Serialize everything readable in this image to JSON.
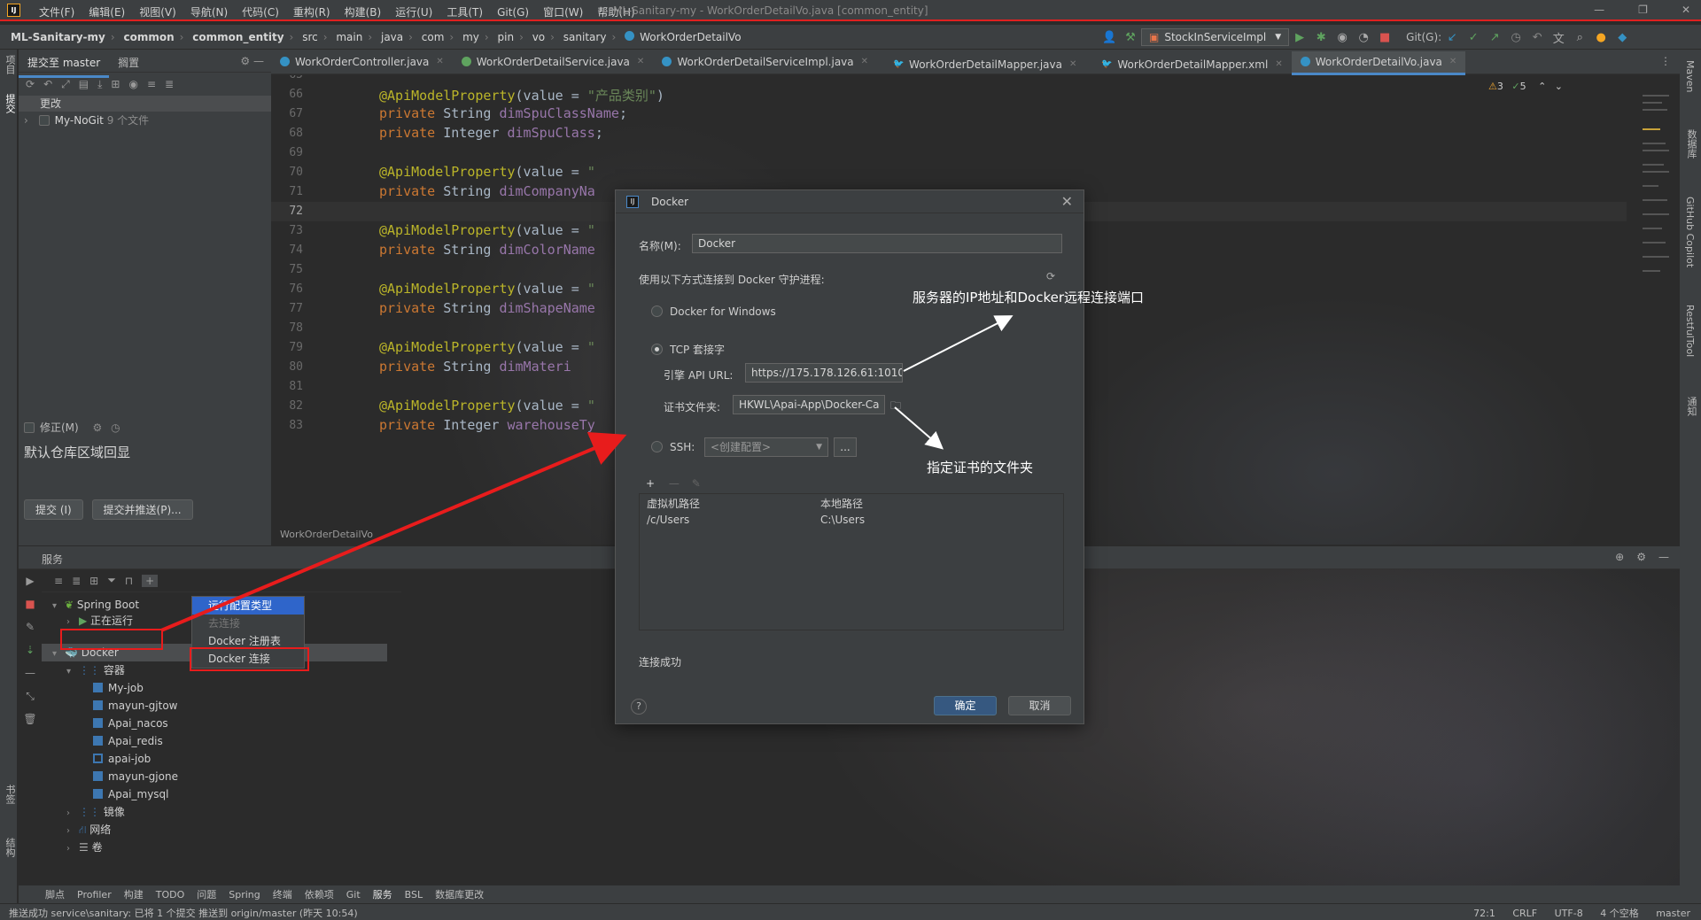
{
  "app": {
    "title": "ML-Sanitary-my - WorkOrderDetailVo.java [common_entity]",
    "menu": [
      "文件(F)",
      "编辑(E)",
      "视图(V)",
      "导航(N)",
      "代码(C)",
      "重构(R)",
      "构建(B)",
      "运行(U)",
      "工具(T)",
      "Git(G)",
      "窗口(W)",
      "帮助(H)"
    ]
  },
  "navbar": {
    "crumbs": [
      "ML-Sanitary-my",
      "common",
      "common_entity",
      "src",
      "main",
      "java",
      "com",
      "my",
      "pin",
      "vo",
      "sanitary",
      "WorkOrderDetailVo"
    ],
    "run_config": "StockInServiceImpl",
    "git_label": "Git(G):"
  },
  "left_strip": {
    "project": "项目",
    "commit": "提交",
    "bookmarks": "书签",
    "structure": "结构"
  },
  "right_strip": {
    "maven": "Maven",
    "database": "数据库",
    "copilot": "GitHub Copilot",
    "restful": "RestfulTool",
    "notifications": "通知"
  },
  "commit_panel": {
    "tab_commit": "提交至 master",
    "tab_shelf": "搁置",
    "changes_group": "更改",
    "repo_name": "My-NoGit",
    "repo_count": "9 个文件",
    "amend_label": "修正(M)",
    "message": "默认仓库区域回显",
    "commit_btn": "提交 (I)",
    "commit_push_btn": "提交并推送(P)..."
  },
  "editor": {
    "tabs": [
      {
        "label": "WorkOrderController.java",
        "icon": "class-icon"
      },
      {
        "label": "WorkOrderDetailService.java",
        "icon": "interface-icon"
      },
      {
        "label": "WorkOrderDetailServiceImpl.java",
        "icon": "class-icon"
      },
      {
        "label": "WorkOrderDetailMapper.java",
        "icon": "mapper-icon"
      },
      {
        "label": "WorkOrderDetailMapper.xml",
        "icon": "xml-icon"
      },
      {
        "label": "WorkOrderDetailVo.java",
        "icon": "class-icon"
      }
    ],
    "inspections": {
      "warnings": "3",
      "ok": "5"
    },
    "line_numbers": [
      "65",
      "66",
      "67",
      "68",
      "69",
      "70",
      "71",
      "72",
      "73",
      "74",
      "75",
      "76",
      "77",
      "78",
      "79",
      "80",
      "81",
      "82",
      "83"
    ],
    "code": {
      "l66_ann": "@ApiModelProperty",
      "l66_str": "\"产品类别\"",
      "l67_name": "dimSpuClassName",
      "l68_name": "dimSpuClass",
      "l71_name": "dimCompanyNa",
      "l74_name": "dimColorName",
      "l77_name": "dimShapeName",
      "l80_name": "dimMateri",
      "l83_name": "warehouseTy",
      "quote": "\"",
      "value_eq": "(value = ",
      "private": "private",
      "string": "String",
      "integer": "Integer"
    },
    "breadcrumb": "WorkOrderDetailVo"
  },
  "services": {
    "title": "服务",
    "tree": {
      "spring_boot": "Spring Boot",
      "running": "正在运行",
      "docker": "Docker",
      "containers": "容器",
      "container_items": [
        "My-job",
        "mayun-gjtow",
        "Apai_nacos",
        "Apai_redis",
        "apai-job",
        "mayun-gjone",
        "Apai_mysql"
      ],
      "images": "镜像",
      "networks": "网络",
      "volumes": "卷"
    },
    "context_menu": [
      "运行配置类型",
      "去连接",
      "Docker 注册表",
      "Docker 连接"
    ]
  },
  "dialog": {
    "title": "Docker",
    "name_label": "名称(M):",
    "name_value": "Docker",
    "connect_label": "使用以下方式连接到 Docker 守护进程:",
    "opt_windows": "Docker for Windows",
    "opt_tcp": "TCP 套接字",
    "api_url_label": "引擎 API URL:",
    "api_url_value": "https://175.178.126.61:1010",
    "cert_label": "证书文件夹:",
    "cert_value": "HKWL\\Apai-App\\Docker-Ca",
    "opt_ssh": "SSH:",
    "ssh_placeholder": "<创建配置>",
    "ssh_more": "...",
    "col_vm_path": "虚拟机路径",
    "col_local_path": "本地路径",
    "row_vm_path": "/c/Users",
    "row_local_path": "C:\\Users",
    "status": "连接成功",
    "ok": "确定",
    "cancel": "取消",
    "help": "?"
  },
  "annotations": {
    "ip_note": "服务器的IP地址和Docker远程连接端口",
    "cert_note": "指定证书的文件夹"
  },
  "tool_windows": [
    "脚点",
    "Profiler",
    "构建",
    "TODO",
    "问题",
    "Spring",
    "终端",
    "依赖项",
    "Git",
    "服务",
    "BSL",
    "数据库更改"
  ],
  "status_bar": {
    "message": "推送成功 service\\sanitary: 已将 1 个提交 推送到 origin/master (昨天 10:54)",
    "position": "72:1",
    "line_sep": "CRLF",
    "encoding": "UTF-8",
    "indent": "4 个空格",
    "branch": "master"
  },
  "colors": {
    "accent": "#4a88c7",
    "annotation_red": "#e81c1c",
    "ok_button": "#365880"
  }
}
